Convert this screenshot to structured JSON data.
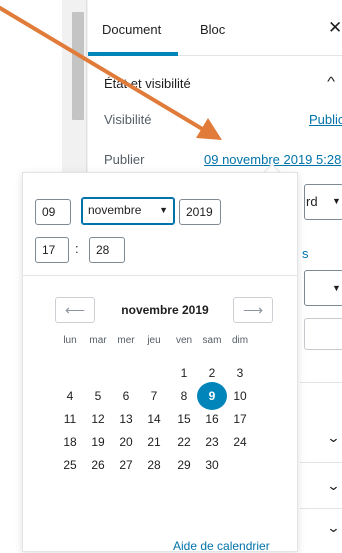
{
  "sidebar": {
    "tabs": [
      {
        "label": "Document",
        "active": true
      },
      {
        "label": "Bloc",
        "active": false
      }
    ],
    "close_icon": "close-icon",
    "panel": {
      "title": "État et visibilité",
      "chevron": "chevron-up-icon",
      "visibility_label": "Visibilité",
      "visibility_value": "Public",
      "publish_label": "Publier",
      "publish_value": "09 novembre 2019 5:28"
    },
    "peek": {
      "select_text": "rd",
      "s_text": "s"
    }
  },
  "datepicker": {
    "day": "09",
    "month": "novembre",
    "year": "2019",
    "hour": "17",
    "minute": "28",
    "month_title": "novembre 2019",
    "prev_icon": "arrow-left-icon",
    "next_icon": "arrow-right-icon",
    "weekdays": [
      "lun",
      "mar",
      "mer",
      "jeu",
      "ven",
      "sam",
      "dim"
    ],
    "days": [
      [
        "",
        "",
        "",
        "",
        "1",
        "2",
        "3"
      ],
      [
        "4",
        "5",
        "6",
        "7",
        "8",
        "9",
        "10"
      ],
      [
        "11",
        "12",
        "13",
        "14",
        "15",
        "16",
        "17"
      ],
      [
        "18",
        "19",
        "20",
        "21",
        "22",
        "23",
        "24"
      ],
      [
        "25",
        "26",
        "27",
        "28",
        "29",
        "30",
        ""
      ]
    ],
    "selected_day": "9",
    "help_link": "Aide de calendrier"
  },
  "colors": {
    "accent": "#0085ba",
    "link": "#0073aa",
    "annotation_arrow": "#e07b39"
  }
}
